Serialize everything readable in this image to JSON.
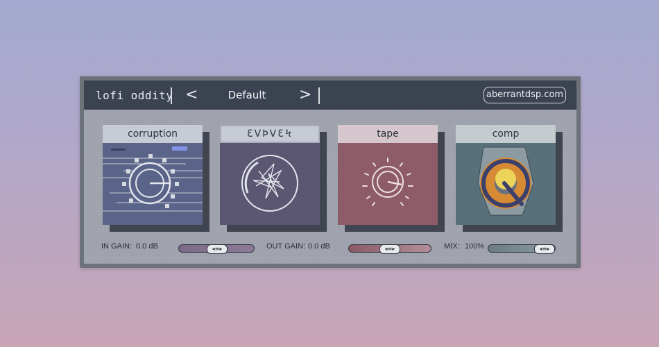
{
  "header": {
    "title": "lofi oddity",
    "preset_prev": "<",
    "preset_next": ">",
    "preset_name": "Default",
    "website": "aberrantdsp.com"
  },
  "modules": [
    {
      "label": "corruption",
      "color": "#5a6488"
    },
    {
      "label": "ƐVϷVƐϞ",
      "color": "#5b5772"
    },
    {
      "label": "tape",
      "color": "#8e5c68"
    },
    {
      "label": "comp",
      "color": "#58707a"
    }
  ],
  "controls": {
    "in_gain_label": "IN GAIN:",
    "in_gain_value": "0.0 dB",
    "out_gain_label": "OUT GAIN:",
    "out_gain_value": "0.0 dB",
    "mix_label": "MIX:",
    "mix_value": "100%",
    "thumb_glyph": "◂≡▸"
  }
}
